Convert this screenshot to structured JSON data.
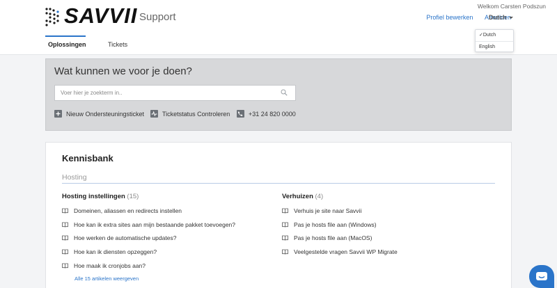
{
  "header": {
    "logo_text": "SAVVII",
    "brand_sub": "Support",
    "welcome": "Welkom Carsten Podszun",
    "links": {
      "profile": "Profiel bewerken",
      "logout": "Afmelden"
    },
    "language": "Dutch"
  },
  "language_menu": {
    "options": [
      "✓Dutch",
      "English"
    ]
  },
  "nav": {
    "tabs": [
      "Oplossingen",
      "Tickets"
    ]
  },
  "search": {
    "title": "Wat kunnen we voor je doen?",
    "placeholder": "Voer hier je zoekterm in..",
    "quick_links": [
      "Nieuw Ondersteuningsticket",
      "Ticketstatus Controleren",
      "+31 24 820 0000"
    ]
  },
  "kb": {
    "title": "Kennisbank",
    "category": "Hosting",
    "sections": [
      {
        "name": "Hosting instellingen",
        "count": "(15)",
        "articles": [
          "Domeinen, aliassen en redirects instellen",
          "Hoe kan ik extra sites aan mijn bestaande pakket toevoegen?",
          "Hoe werken de automatische updates?",
          "Hoe kan ik diensten opzeggen?",
          "Hoe maak ik cronjobs aan?"
        ],
        "more": "Alle 15 artikelen weergeven"
      },
      {
        "name": "Verhuizen",
        "count": "(4)",
        "articles": [
          "Verhuis je site naar Savvii",
          "Pas je hosts file aan (Windows)",
          "Pas je hosts file aan (MacOS)",
          "Veelgestelde vragen Savvii WP Migrate"
        ]
      }
    ]
  },
  "colors": {
    "accent": "#2a74c9",
    "panel": "#d7d8da"
  }
}
